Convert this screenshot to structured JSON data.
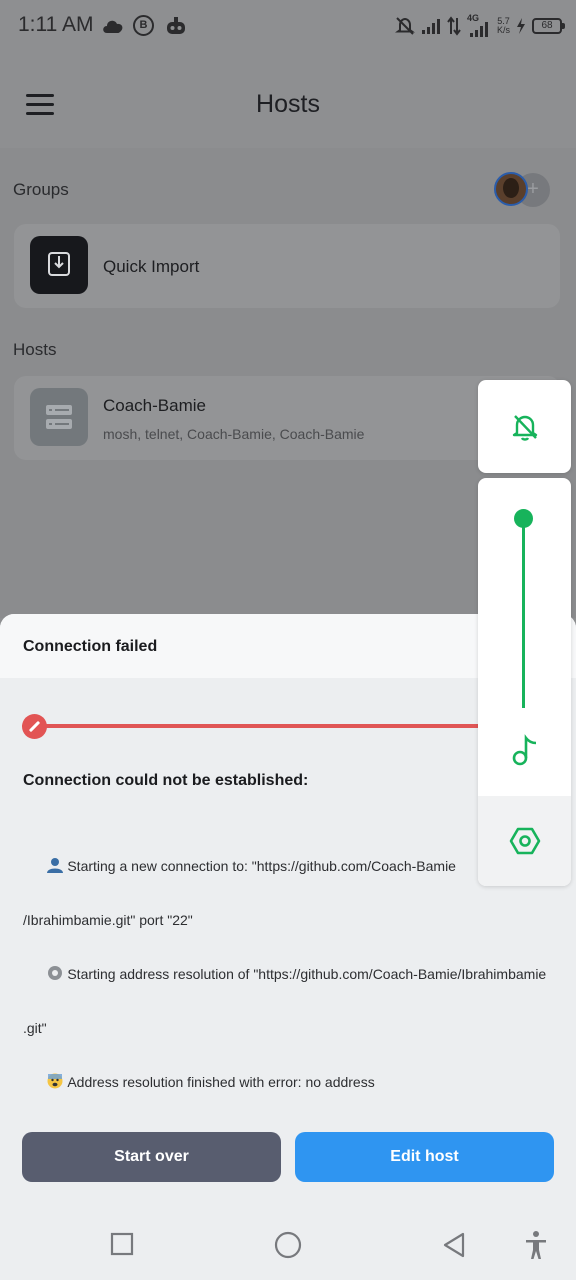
{
  "status_bar": {
    "time": "1:11 AM",
    "b_badge": "B",
    "network": "4G",
    "speed_value": "5.7",
    "speed_unit": "K/s",
    "battery": "68",
    "icons": [
      "cloud-icon",
      "b-badge-icon",
      "robot-icon",
      "bell-off-icon",
      "signal-icon",
      "data-arrows-icon",
      "signal-4g-icon",
      "charging-icon",
      "battery-icon"
    ]
  },
  "app_bar": {
    "title": "Hosts",
    "menu_icon": "menu-icon"
  },
  "groups": {
    "label": "Groups",
    "quick_import": {
      "label": "Quick Import",
      "icon": "import-icon"
    },
    "add_icon": "plus-icon"
  },
  "hosts": {
    "label": "Hosts",
    "items": [
      {
        "name": "Coach-Bamie",
        "subtitle": "mosh, telnet, Coach-Bamie, Coach-Bamie",
        "icon": "server-icon"
      }
    ]
  },
  "sheet": {
    "title": "Connection failed",
    "heading": "Connection could not be established:",
    "log": [
      {
        "emoji": "person-icon",
        "text": "Starting a new connection to: \"https://github.com/Coach-Bamie"
      },
      {
        "emoji": "",
        "text": "/Ibrahimbamie.git\" port \"22\""
      },
      {
        "emoji": "gear-emoji-icon",
        "text": "Starting address resolution of \"https://github.com/Coach-Bamie/Ibrahimbamie"
      },
      {
        "emoji": "",
        "text": ".git\""
      },
      {
        "emoji": "scared-face-icon",
        "text": "Address resolution finished with error: no address"
      }
    ],
    "buttons": {
      "start_over": "Start over",
      "edit_host": "Edit host"
    },
    "colors": {
      "error": "#e25454",
      "primary": "#2f95f1",
      "secondary": "#585d6f"
    }
  },
  "volume_panel": {
    "level": 1.0,
    "icons": [
      "bell-off-icon",
      "music-note-icon",
      "settings-icon"
    ],
    "accent": "#17b35b"
  },
  "nav_bar": {
    "icons": [
      "recents-square-icon",
      "home-circle-icon",
      "back-triangle-icon",
      "accessibility-icon"
    ]
  }
}
